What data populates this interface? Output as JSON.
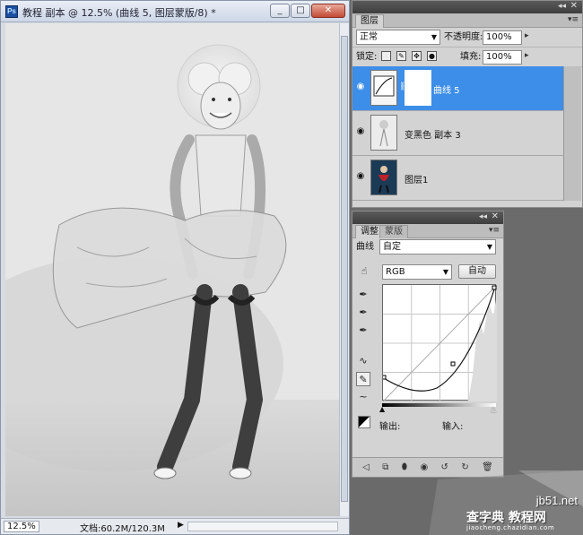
{
  "document": {
    "title": "教程 副本 @ 12.5% (曲线 5, 图层蒙版/8) *",
    "app_icon": "Ps",
    "window_buttons": [
      "_",
      "□",
      "✕"
    ],
    "zoom": "12.5%",
    "doc_info": "文档:60.2M/120.3M",
    "status_arrow": "▶"
  },
  "layers_panel": {
    "tab": "图层",
    "blend_mode": "正常",
    "opacity_label": "不透明度:",
    "opacity_value": "100%",
    "lock_label": "锁定:",
    "fill_label": "填充:",
    "fill_value": "100%",
    "layers": [
      {
        "name": "曲线 5",
        "selected": true
      },
      {
        "name": "变黑色 副本 3",
        "selected": false
      },
      {
        "name": "图层1",
        "selected": false
      }
    ]
  },
  "adjustments_panel": {
    "tabs": [
      "调整",
      "蒙版"
    ],
    "type_label": "曲线",
    "preset": "自定",
    "channel": "RGB",
    "auto_button": "自动",
    "output_label": "输出:",
    "input_label": "输入:"
  },
  "watermark": {
    "url": "jb51.net",
    "main": "查字典 教程网",
    "sub": "jiaocheng.chazidian.com"
  },
  "colors": {
    "selection": "#3d8ee8",
    "panel_bg": "#d3d3d3",
    "workspace": "#6b6b6b"
  }
}
